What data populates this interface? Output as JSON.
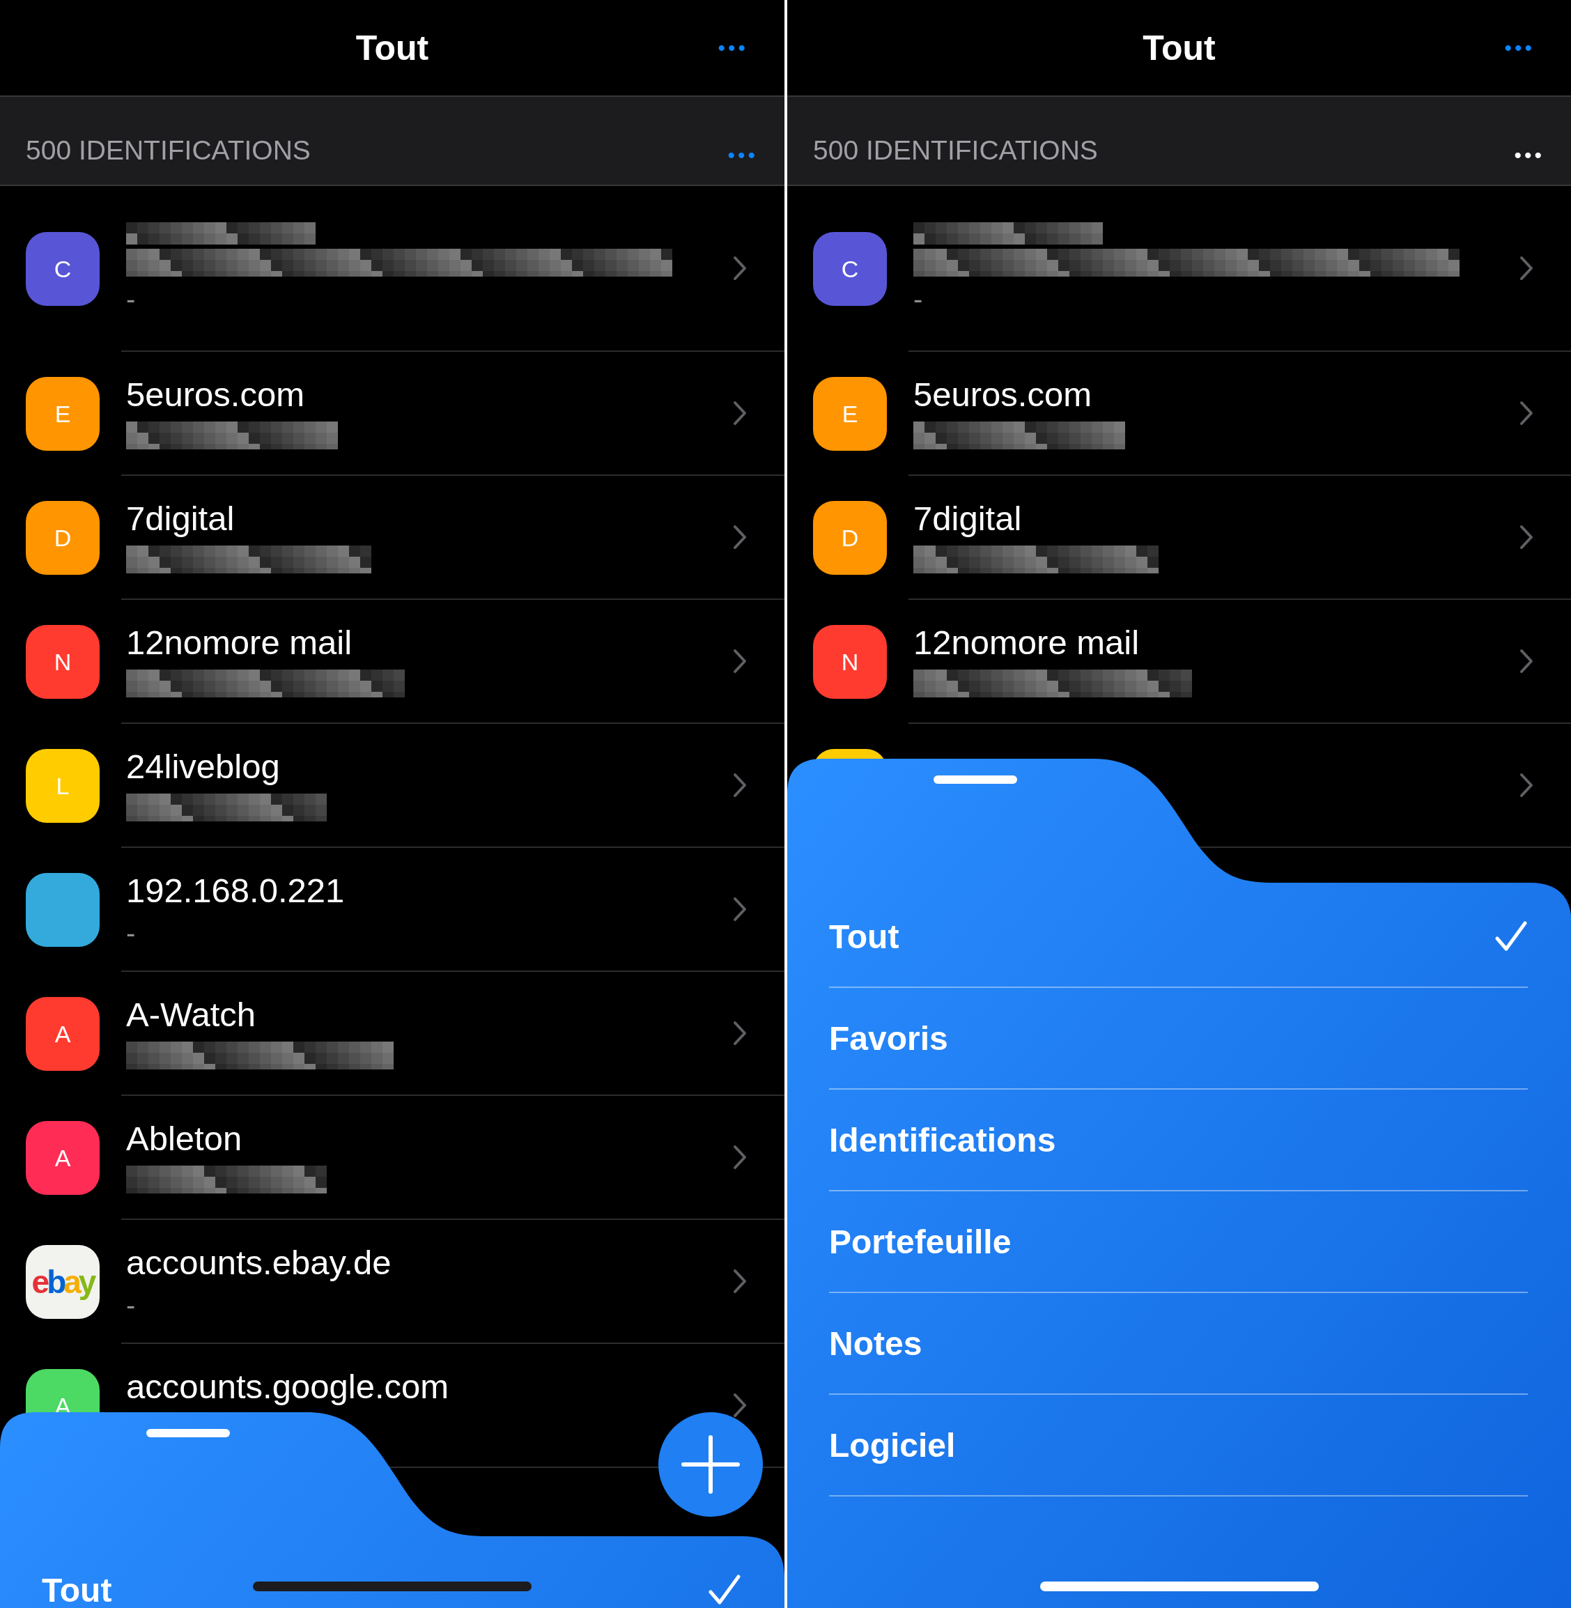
{
  "panels": [
    {
      "nav": {
        "title": "Tout",
        "dots": "•••"
      },
      "header": {
        "title": "500 IDENTIFICATIONS",
        "dots": "•••",
        "dots_highlighted": true
      },
      "rows": [
        {
          "letter": "C",
          "color": "#5856d6",
          "title_blurred": true,
          "detail": "-"
        },
        {
          "letter": "E",
          "color": "#ff9500",
          "title": "5euros.com",
          "detail_blurred": true
        },
        {
          "letter": "D",
          "color": "#ff9500",
          "title": "7digital",
          "detail_blurred": true
        },
        {
          "letter": "N",
          "color": "#ff3b30",
          "title": "12nomore mail",
          "detail_blurred": true
        },
        {
          "letter": "L",
          "color": "#ffcc00",
          "title": "24liveblog",
          "detail_blurred": true
        },
        {
          "color": "#34aadc",
          "title": "192.168.0.221",
          "detail": "-"
        },
        {
          "letter": "A",
          "color": "#ff3b30",
          "title": "A-Watch",
          "detail_blurred": true
        },
        {
          "letter": "A",
          "color": "#ff2d55",
          "title": "Ableton",
          "detail_blurred": true
        },
        {
          "kind": "logo",
          "logo": [
            {
              "text": "e",
              "color": "#e53238"
            },
            {
              "text": "b",
              "color": "#0064d2"
            },
            {
              "text": "a",
              "color": "#f5af02"
            },
            {
              "text": "y",
              "color": "#86b817"
            }
          ],
          "color": "#f2f2ee",
          "title": "accounts.ebay.de",
          "detail": "-"
        },
        {
          "letter": "A",
          "color": "#4cd964",
          "title": "accounts.google.com"
        }
      ],
      "sheet": {
        "expanded": false,
        "items": [
          {
            "label": "Tout",
            "selected": true
          }
        ]
      },
      "add_button": true,
      "home_indicator": {
        "dark": true
      }
    },
    {
      "nav": {
        "title": "Tout",
        "dots": "•••"
      },
      "header": {
        "title": "500 IDENTIFICATIONS",
        "dots": "•••",
        "dots_highlighted": false
      },
      "rows": [
        {
          "letter": "C",
          "color": "#5856d6",
          "title_blurred": true,
          "detail": "-"
        },
        {
          "letter": "E",
          "color": "#ff9500",
          "title": "5euros.com",
          "detail_blurred": true
        },
        {
          "letter": "D",
          "color": "#ff9500",
          "title": "7digital",
          "detail_blurred": true
        },
        {
          "letter": "N",
          "color": "#ff3b30",
          "title": "12nomore mail",
          "detail_blurred": true
        },
        {
          "color": "#ffcc00"
        }
      ],
      "sheet": {
        "expanded": true,
        "items": [
          {
            "label": "Tout",
            "selected": true
          },
          {
            "label": "Favoris",
            "selected": false
          },
          {
            "label": "Identifications",
            "selected": false
          },
          {
            "label": "Portefeuille",
            "selected": false
          },
          {
            "label": "Notes",
            "selected": false
          },
          {
            "label": "Logiciel",
            "selected": false
          }
        ]
      },
      "home_indicator": {
        "dark": false
      }
    }
  ]
}
